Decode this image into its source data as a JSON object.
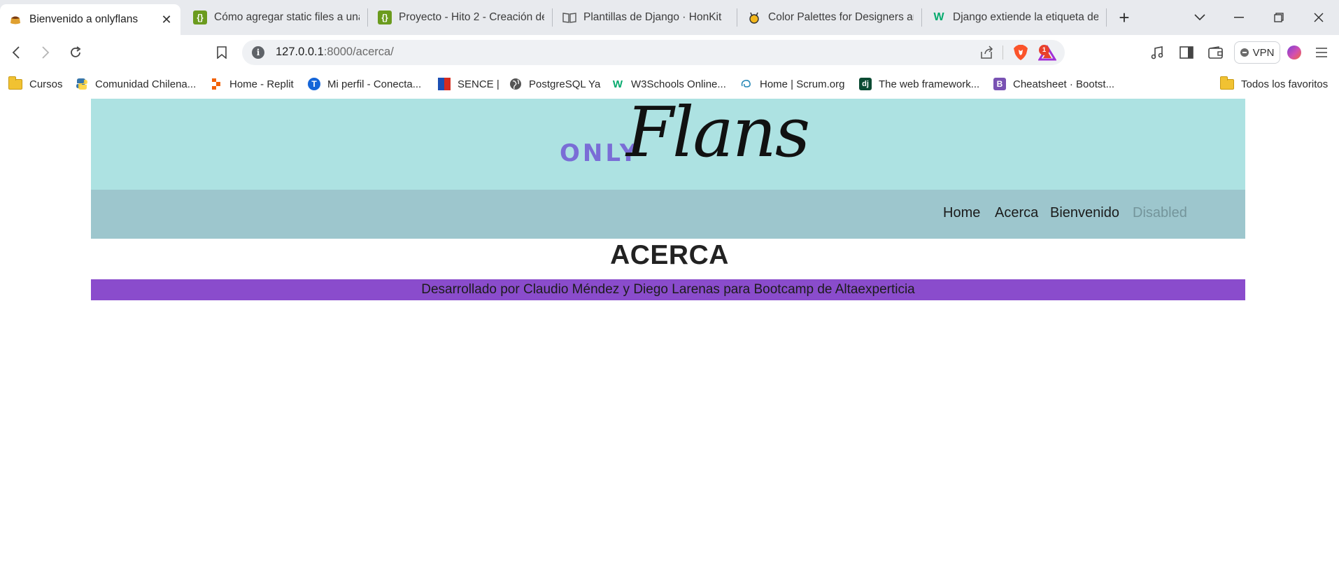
{
  "browser": {
    "tabs": [
      {
        "title": "Bienvenido a onlyflans",
        "active": true,
        "icon": "flan-icon"
      },
      {
        "title": "Cómo agregar static files a una",
        "icon": "bracket-icon"
      },
      {
        "title": "Proyecto - Hito 2 - Creación de",
        "icon": "bracket-icon"
      },
      {
        "title": "Plantillas de Django · HonKit",
        "icon": "book-icon"
      },
      {
        "title": "Color Palettes for Designers and",
        "icon": "palette-icon"
      },
      {
        "title": "Django extiende la etiqueta de",
        "icon": "w-icon"
      }
    ],
    "close_glyph": "✕",
    "new_tab_glyph": "+",
    "address": {
      "host": "127.0.0.1",
      "rest": ":8000/acerca/",
      "info_glyph": "i"
    },
    "rewards_badge": "1",
    "vpn_label": "VPN",
    "bookmarks": [
      {
        "label": "Cursos",
        "icon": "folder-icon"
      },
      {
        "label": "Comunidad Chilena...",
        "icon": "python-icon"
      },
      {
        "label": "Home - Replit",
        "icon": "replit-icon"
      },
      {
        "label": "Mi perfil - Conecta...",
        "icon": "t-icon"
      },
      {
        "label": "SENCE |",
        "icon": "flag-icon"
      },
      {
        "label": "PostgreSQL Ya",
        "icon": "globe-icon"
      },
      {
        "label": "W3Schools Online...",
        "icon": "w3-icon"
      },
      {
        "label": "Home | Scrum.org",
        "icon": "scrum-icon"
      },
      {
        "label": "The web framework...",
        "icon": "django-icon"
      },
      {
        "label": "Cheatsheet · Bootst...",
        "icon": "bootstrap-icon"
      }
    ],
    "all_bookmarks": "Todos los favoritos"
  },
  "site": {
    "logo_only": "ONLY",
    "logo_flans": "Flans",
    "nav": [
      {
        "label": "Home",
        "disabled": false
      },
      {
        "label": "Acerca",
        "disabled": false
      },
      {
        "label": "Bienvenido",
        "disabled": false
      },
      {
        "label": "Disabled",
        "disabled": true
      }
    ],
    "page_title": "ACERCA",
    "footer": "Desarrollado por Claudio Méndez y Diego Larenas para Bootcamp de Altaexperticia"
  },
  "colors": {
    "header_bg": "#ade2e2",
    "nav_bg": "#9dc6cd",
    "footer_bg": "#8a4ccc",
    "logo_only": "#7a6dd6"
  }
}
